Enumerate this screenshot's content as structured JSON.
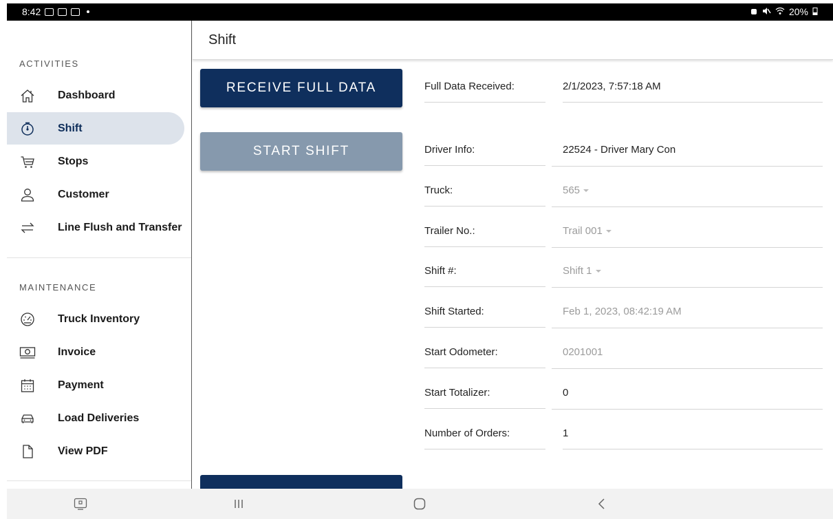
{
  "status_bar": {
    "time": "8:42",
    "battery": "20%"
  },
  "page": {
    "title": "Shift"
  },
  "sidebar": {
    "activities_title": "ACTIVITIES",
    "maintenance_title": "MAINTENANCE",
    "activities": [
      {
        "label": "Dashboard",
        "icon": "home-icon"
      },
      {
        "label": "Shift",
        "icon": "stopwatch-icon",
        "active": true
      },
      {
        "label": "Stops",
        "icon": "cart-icon"
      },
      {
        "label": "Customer",
        "icon": "person-icon"
      },
      {
        "label": "Line Flush and Transfer",
        "icon": "transfer-arrows-icon"
      }
    ],
    "maintenance": [
      {
        "label": "Truck Inventory",
        "icon": "gauge-icon"
      },
      {
        "label": "Invoice",
        "icon": "cash-icon"
      },
      {
        "label": "Payment",
        "icon": "calendar-icon"
      },
      {
        "label": "Load Deliveries",
        "icon": "car-icon"
      },
      {
        "label": "View PDF",
        "icon": "document-icon"
      }
    ]
  },
  "buttons": {
    "receive_full_data": "RECEIVE FULL DATA",
    "start_shift": "START SHIFT"
  },
  "fields": {
    "full_data_received": {
      "label": "Full Data Received:",
      "value": "2/1/2023, 7:57:18 AM"
    },
    "driver_info": {
      "label": "Driver Info:",
      "value": "22524 - Driver Mary Con"
    },
    "truck": {
      "label": "Truck:",
      "value": "565"
    },
    "trailer_no": {
      "label": "Trailer No.:",
      "value": "Trail 001"
    },
    "shift_no": {
      "label": "Shift #:",
      "value": "Shift 1"
    },
    "shift_started": {
      "label": "Shift Started:",
      "value": "Feb 1, 2023, 08:42:19 AM"
    },
    "start_odometer": {
      "label": "Start Odometer:",
      "value": "0201001"
    },
    "start_totalizer": {
      "label": "Start Totalizer:",
      "value": "0"
    },
    "number_of_orders": {
      "label": "Number of Orders:",
      "value": "1"
    }
  },
  "colors": {
    "primary": "#0f2f5d",
    "disabled": "#8699ad",
    "active_bg": "#dde3eb"
  }
}
